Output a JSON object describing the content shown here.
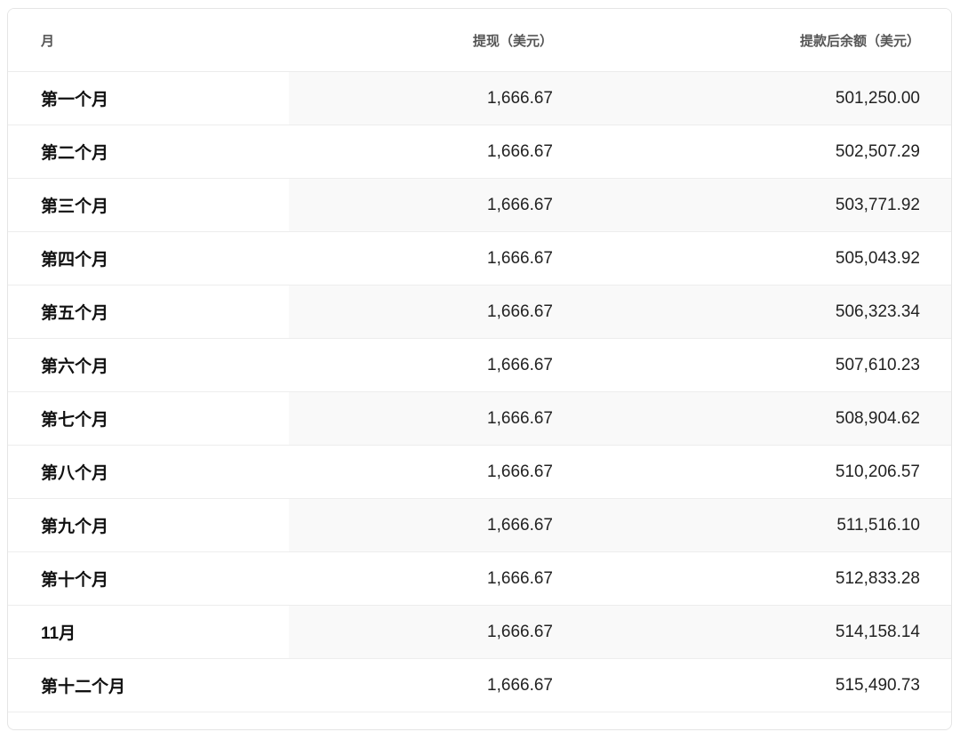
{
  "table": {
    "headers": {
      "month": "月",
      "withdrawal": "提现（美元）",
      "balance": "提款后余额（美元）"
    },
    "rows": [
      {
        "month": "第一个月",
        "withdrawal": "1,666.67",
        "balance": "501,250.00"
      },
      {
        "month": "第二个月",
        "withdrawal": "1,666.67",
        "balance": "502,507.29"
      },
      {
        "month": "第三个月",
        "withdrawal": "1,666.67",
        "balance": "503,771.92"
      },
      {
        "month": "第四个月",
        "withdrawal": "1,666.67",
        "balance": "505,043.92"
      },
      {
        "month": "第五个月",
        "withdrawal": "1,666.67",
        "balance": "506,323.34"
      },
      {
        "month": "第六个月",
        "withdrawal": "1,666.67",
        "balance": "507,610.23"
      },
      {
        "month": "第七个月",
        "withdrawal": "1,666.67",
        "balance": "508,904.62"
      },
      {
        "month": "第八个月",
        "withdrawal": "1,666.67",
        "balance": "510,206.57"
      },
      {
        "month": "第九个月",
        "withdrawal": "1,666.67",
        "balance": "511,516.10"
      },
      {
        "month": "第十个月",
        "withdrawal": "1,666.67",
        "balance": "512,833.28"
      },
      {
        "month": "11月",
        "withdrawal": "1,666.67",
        "balance": "514,158.14"
      },
      {
        "month": "第十二个月",
        "withdrawal": "1,666.67",
        "balance": "515,490.73"
      }
    ]
  }
}
